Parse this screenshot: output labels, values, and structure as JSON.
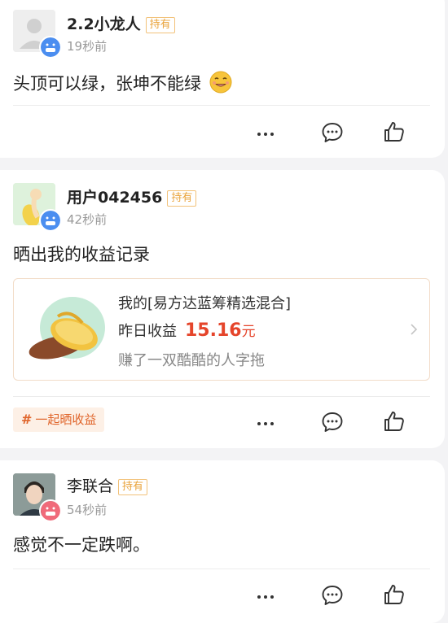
{
  "posts": [
    {
      "username": "2.2小龙人",
      "badge": "持有",
      "time": "19秒前",
      "content": "头顶可以绿，张坤不能绿",
      "emoji_icon": "drooling-face-icon"
    },
    {
      "username": "用户042456",
      "badge": "持有",
      "time": "42秒前",
      "content": "晒出我的收益记录",
      "share_card": {
        "title": "我的[易方达蓝筹精选混合]",
        "profit_label": "昨日收益",
        "profit_value": "15.16",
        "profit_unit": "元",
        "subtitle": "赚了一双酷酷的人字拖",
        "image_icon": "flip-flops-icon"
      },
      "hashtag": {
        "symbol": "#",
        "label": "一起晒收益"
      }
    },
    {
      "username": "李联合",
      "badge": "持有",
      "time": "54秒前",
      "content": "感觉不一定跌啊。"
    }
  ],
  "actions": {
    "more_icon": "more-dots-icon",
    "comment_icon": "comment-bubble-icon",
    "like_icon": "thumbs-up-icon"
  },
  "colors": {
    "badge": "#e9a33b",
    "profit": "#e5452b",
    "hashtag": "#e0652b",
    "hashtag_bg": "#fdf0e6"
  }
}
